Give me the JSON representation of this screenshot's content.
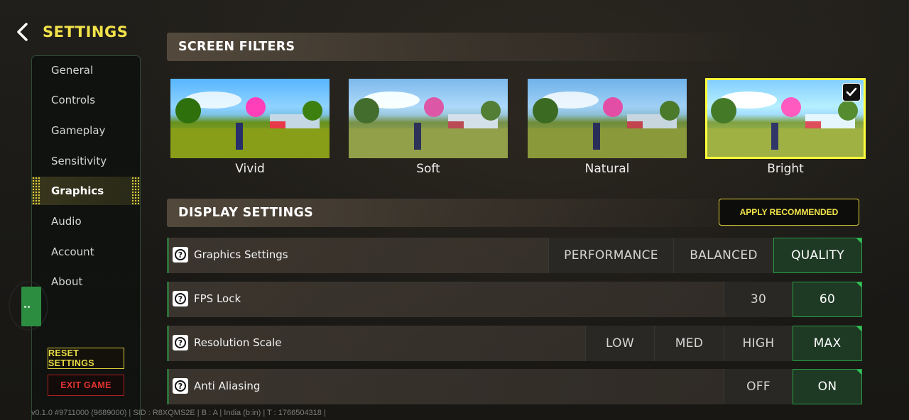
{
  "header": {
    "title": "SETTINGS"
  },
  "sidebar": {
    "items": [
      {
        "label": "General"
      },
      {
        "label": "Controls"
      },
      {
        "label": "Gameplay"
      },
      {
        "label": "Sensitivity"
      },
      {
        "label": "Graphics",
        "active": true
      },
      {
        "label": "Audio"
      },
      {
        "label": "Account"
      },
      {
        "label": "About"
      }
    ],
    "reset_label": "RESET SETTINGS",
    "exit_label": "EXIT GAME"
  },
  "footer": {
    "info": "v0.1.0 #9711000 (9689000)  |  SID : R8XQMS2E  |  B : A  |  India (b:in)  |  T : 1766504318  |"
  },
  "screen_filters": {
    "title": "SCREEN FILTERS",
    "options": [
      {
        "label": "Vivid"
      },
      {
        "label": "Soft"
      },
      {
        "label": "Natural"
      },
      {
        "label": "Bright",
        "selected": true
      }
    ]
  },
  "display_settings": {
    "title": "DISPLAY SETTINGS",
    "apply_label": "APPLY RECOMMENDED",
    "rows": [
      {
        "label": "Graphics Settings",
        "options": [
          "PERFORMANCE",
          "BALANCED",
          "QUALITY"
        ],
        "selected": "QUALITY"
      },
      {
        "label": "FPS Lock",
        "options": [
          "30",
          "60"
        ],
        "selected": "60"
      },
      {
        "label": "Resolution Scale",
        "options": [
          "LOW",
          "MED",
          "HIGH",
          "MAX"
        ],
        "selected": "MAX"
      },
      {
        "label": "Anti Aliasing",
        "options": [
          "OFF",
          "ON"
        ],
        "selected": "ON"
      }
    ]
  },
  "colors": {
    "accent_yellow": "#f1e24a",
    "selected_green": "#2a9d46",
    "exit_red": "#e0332e"
  }
}
